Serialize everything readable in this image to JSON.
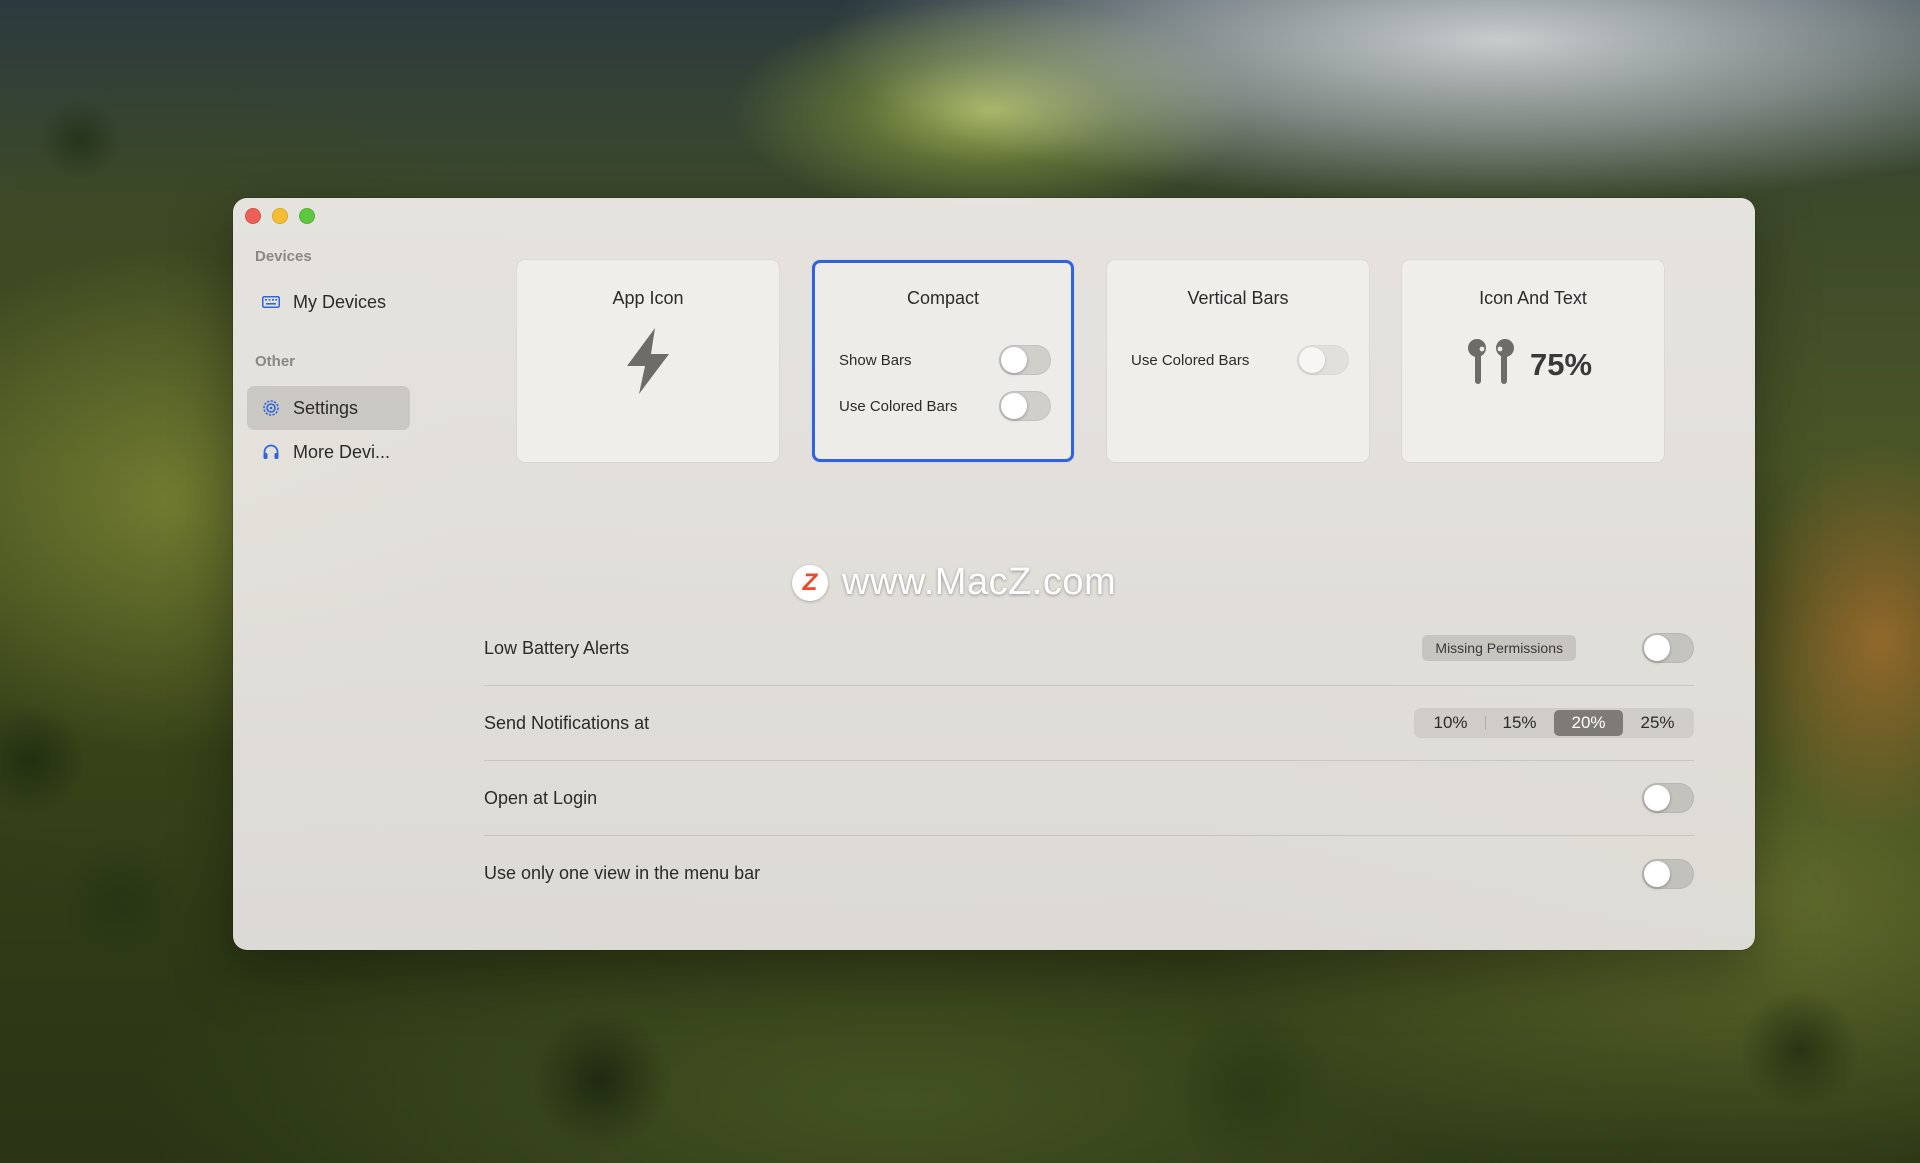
{
  "sidebar": {
    "devices_header": "Devices",
    "other_header": "Other",
    "items": [
      {
        "label": "My Devices",
        "icon": "keyboard-icon"
      },
      {
        "label": "Settings",
        "icon": "gear-icon",
        "selected": true
      },
      {
        "label": "More Devi...",
        "icon": "headphones-icon"
      }
    ]
  },
  "styles": {
    "cards": [
      {
        "title": "App Icon",
        "icon": "lightning-bolt-icon"
      },
      {
        "title": "Compact",
        "selected": true,
        "options": [
          {
            "label": "Show Bars",
            "on": false
          },
          {
            "label": "Use Colored Bars",
            "on": false
          }
        ]
      },
      {
        "title": "Vertical Bars",
        "options": [
          {
            "label": "Use Colored Bars",
            "on": false,
            "disabled": true
          }
        ]
      },
      {
        "title": "Icon And Text",
        "icon": "airpods-icon",
        "value": "75%"
      }
    ]
  },
  "settings": {
    "low_battery": {
      "label": "Low Battery Alerts",
      "badge": "Missing Permissions",
      "on": false
    },
    "notifications": {
      "label": "Send Notifications at",
      "options": [
        "10%",
        "15%",
        "20%",
        "25%"
      ],
      "selected": "20%"
    },
    "login": {
      "label": "Open at Login",
      "on": false
    },
    "one_view": {
      "label": "Use only one view in the menu bar",
      "on": false
    }
  },
  "watermark": {
    "logo": "Z",
    "text": "www.MacZ.com"
  },
  "colors": {
    "accent": "#2f63e0",
    "selected_segment": "#7e7b77",
    "sidebar_icon": "#2f63e0"
  }
}
